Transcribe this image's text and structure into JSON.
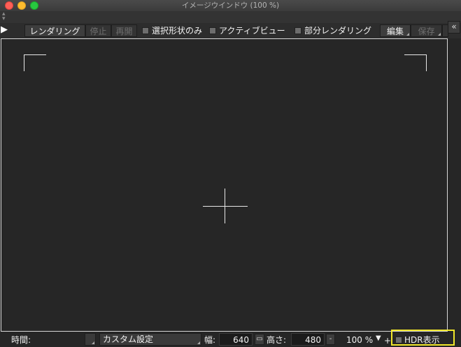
{
  "window": {
    "title": "イメージウインドウ (100 %)"
  },
  "toolbar": {
    "render_label": "レンダリング",
    "stop_label": "停止",
    "resume_label": "再開",
    "selected_only_label": "選択形状のみ",
    "active_view_label": "アクティブビュー",
    "partial_render_label": "部分レンダリング",
    "edit_label": "編集",
    "save_label": "保存",
    "collapse_glyph": "«"
  },
  "status": {
    "time_label": "時間:",
    "preset_value": "カスタム設定",
    "width_label": "幅:",
    "width_value": "640",
    "height_label": "高さ:",
    "height_value": "480",
    "zoom_value": "100 %",
    "zoom_down": "▼",
    "zoom_up": "+",
    "minus": "-",
    "hdr_label": "HDR表示"
  },
  "icons": {
    "play": "play-icon",
    "sort": "sort-arrows-icon",
    "link": "link-icon",
    "collapse": "double-chevron-left-icon"
  },
  "colors": {
    "highlight": "#f0e62a",
    "background": "#262626"
  }
}
